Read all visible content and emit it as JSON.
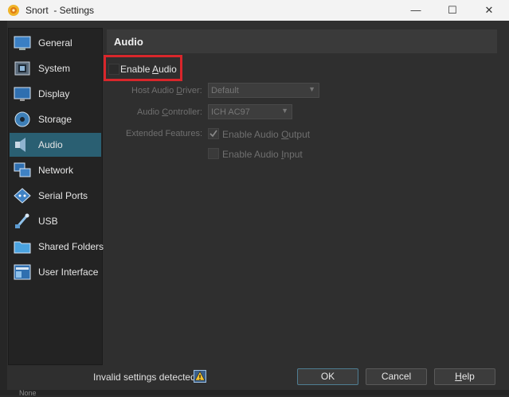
{
  "window": {
    "title": "Snort  - Settings",
    "minimize": "—",
    "maximize": "☐",
    "close": "✕"
  },
  "sidebar": {
    "items": [
      {
        "label": "General",
        "icon": "general-icon"
      },
      {
        "label": "System",
        "icon": "system-icon"
      },
      {
        "label": "Display",
        "icon": "display-icon"
      },
      {
        "label": "Storage",
        "icon": "storage-icon"
      },
      {
        "label": "Audio",
        "icon": "audio-icon",
        "active": true
      },
      {
        "label": "Network",
        "icon": "network-icon"
      },
      {
        "label": "Serial Ports",
        "icon": "serial-ports-icon"
      },
      {
        "label": "USB",
        "icon": "usb-icon"
      },
      {
        "label": "Shared Folders",
        "icon": "shared-folders-icon"
      },
      {
        "label": "User Interface",
        "icon": "user-interface-icon"
      }
    ]
  },
  "main": {
    "title": "Audio",
    "enable_audio": {
      "prefix": "Enable ",
      "accel": "A",
      "suffix": "udio",
      "checked": false
    },
    "host_driver": {
      "label_prefix": "Host Audio ",
      "label_accel": "D",
      "label_suffix": "river:",
      "value": "Default"
    },
    "controller": {
      "label_prefix": "Audio ",
      "label_accel": "C",
      "label_suffix": "ontroller:",
      "value": "ICH AC97"
    },
    "extended_label": "Extended Features:",
    "audio_output": {
      "prefix": "Enable Audio ",
      "accel": "O",
      "suffix": "utput",
      "checked": true
    },
    "audio_input": {
      "prefix": "Enable Audio ",
      "accel": "I",
      "suffix": "nput",
      "checked": false
    }
  },
  "footer": {
    "status": "Invalid settings detected",
    "ok": "OK",
    "cancel": "Cancel",
    "help_accel": "H",
    "help_rest": "elp",
    "fragment": "None"
  },
  "colors": {
    "accent": "#2a5f72",
    "highlight": "#d9262b",
    "background": "#2f2f2f"
  }
}
